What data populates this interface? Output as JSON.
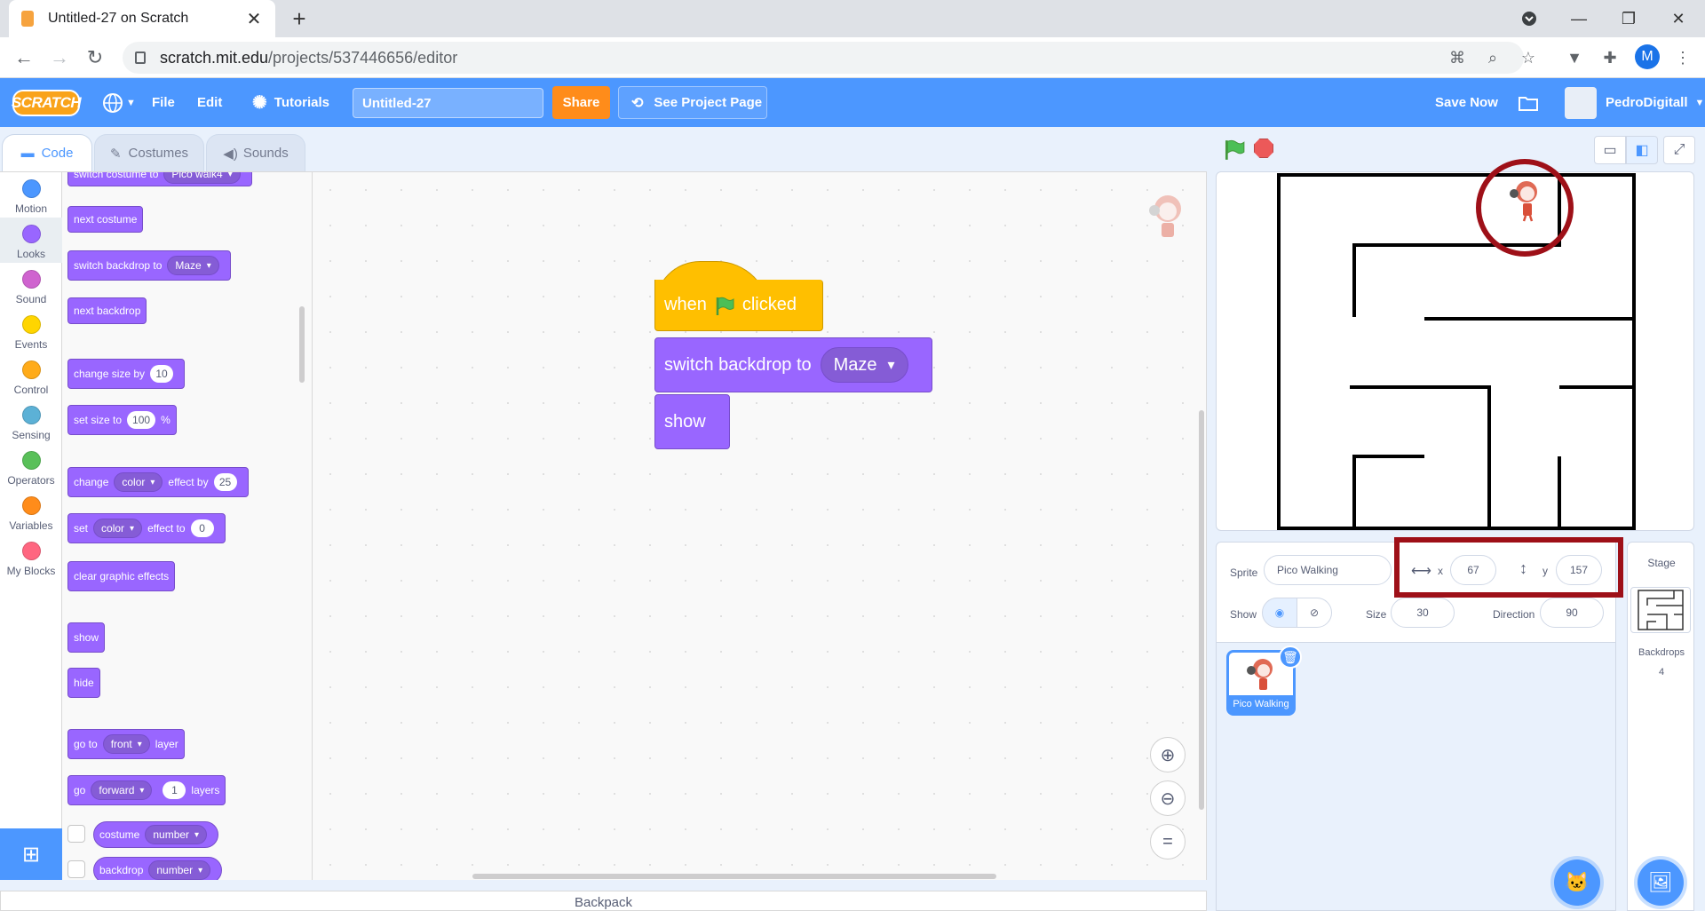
{
  "browser": {
    "tab_title": "Untitled-27 on Scratch",
    "url_host": "scratch.mit.edu",
    "url_path": "/projects/537446656/editor",
    "profile_initial": "M"
  },
  "menubar": {
    "logo": "SCRATCH",
    "file": "File",
    "edit": "Edit",
    "tutorials": "Tutorials",
    "project_title": "Untitled-27",
    "share": "Share",
    "see_project_page": "See Project Page",
    "save_now": "Save Now",
    "username": "PedroDigitall"
  },
  "editor_tabs": {
    "code": "Code",
    "costumes": "Costumes",
    "sounds": "Sounds"
  },
  "categories": [
    {
      "label": "Motion",
      "color": "#4c97ff"
    },
    {
      "label": "Looks",
      "color": "#9966ff"
    },
    {
      "label": "Sound",
      "color": "#cf63cf"
    },
    {
      "label": "Events",
      "color": "#ffd500"
    },
    {
      "label": "Control",
      "color": "#ffab19"
    },
    {
      "label": "Sensing",
      "color": "#5cb1d6"
    },
    {
      "label": "Operators",
      "color": "#59c059"
    },
    {
      "label": "Variables",
      "color": "#ff8c1a"
    },
    {
      "label": "My Blocks",
      "color": "#ff6680"
    }
  ],
  "palette": {
    "switch_costume": "switch costume to",
    "costume_val": "Pico walk4",
    "next_costume": "next costume",
    "switch_backdrop": "switch backdrop to",
    "backdrop_val": "Maze",
    "next_backdrop": "next backdrop",
    "change_size": "change size by",
    "change_size_val": "10",
    "set_size": "set size to",
    "set_size_val": "100",
    "percent": "%",
    "change": "change",
    "effect_color": "color",
    "effect_by": "effect by",
    "effect_by_val": "25",
    "set": "set",
    "effect_to": "effect to",
    "effect_to_val": "0",
    "clear_effects": "clear graphic effects",
    "show": "show",
    "hide": "hide",
    "go_to": "go to",
    "front": "front",
    "layer": "layer",
    "go": "go",
    "forward": "forward",
    "layers_val": "1",
    "layers": "layers",
    "costume": "costume",
    "number": "number",
    "backdrop": "backdrop"
  },
  "script": {
    "when": "when",
    "clicked": "clicked",
    "switch_backdrop": "switch backdrop to",
    "backdrop_val": "Maze",
    "show": "show"
  },
  "backpack": "Backpack",
  "sprite_info": {
    "sprite_label": "Sprite",
    "sprite_name": "Pico Walking",
    "x_label": "x",
    "x_value": "67",
    "y_label": "y",
    "y_value": "157",
    "show_label": "Show",
    "size_label": "Size",
    "size_value": "30",
    "direction_label": "Direction",
    "direction_value": "90"
  },
  "sprite_tile_name": "Pico Walking",
  "stage_panel": {
    "title": "Stage",
    "backdrops_label": "Backdrops",
    "backdrops_count": "4"
  }
}
